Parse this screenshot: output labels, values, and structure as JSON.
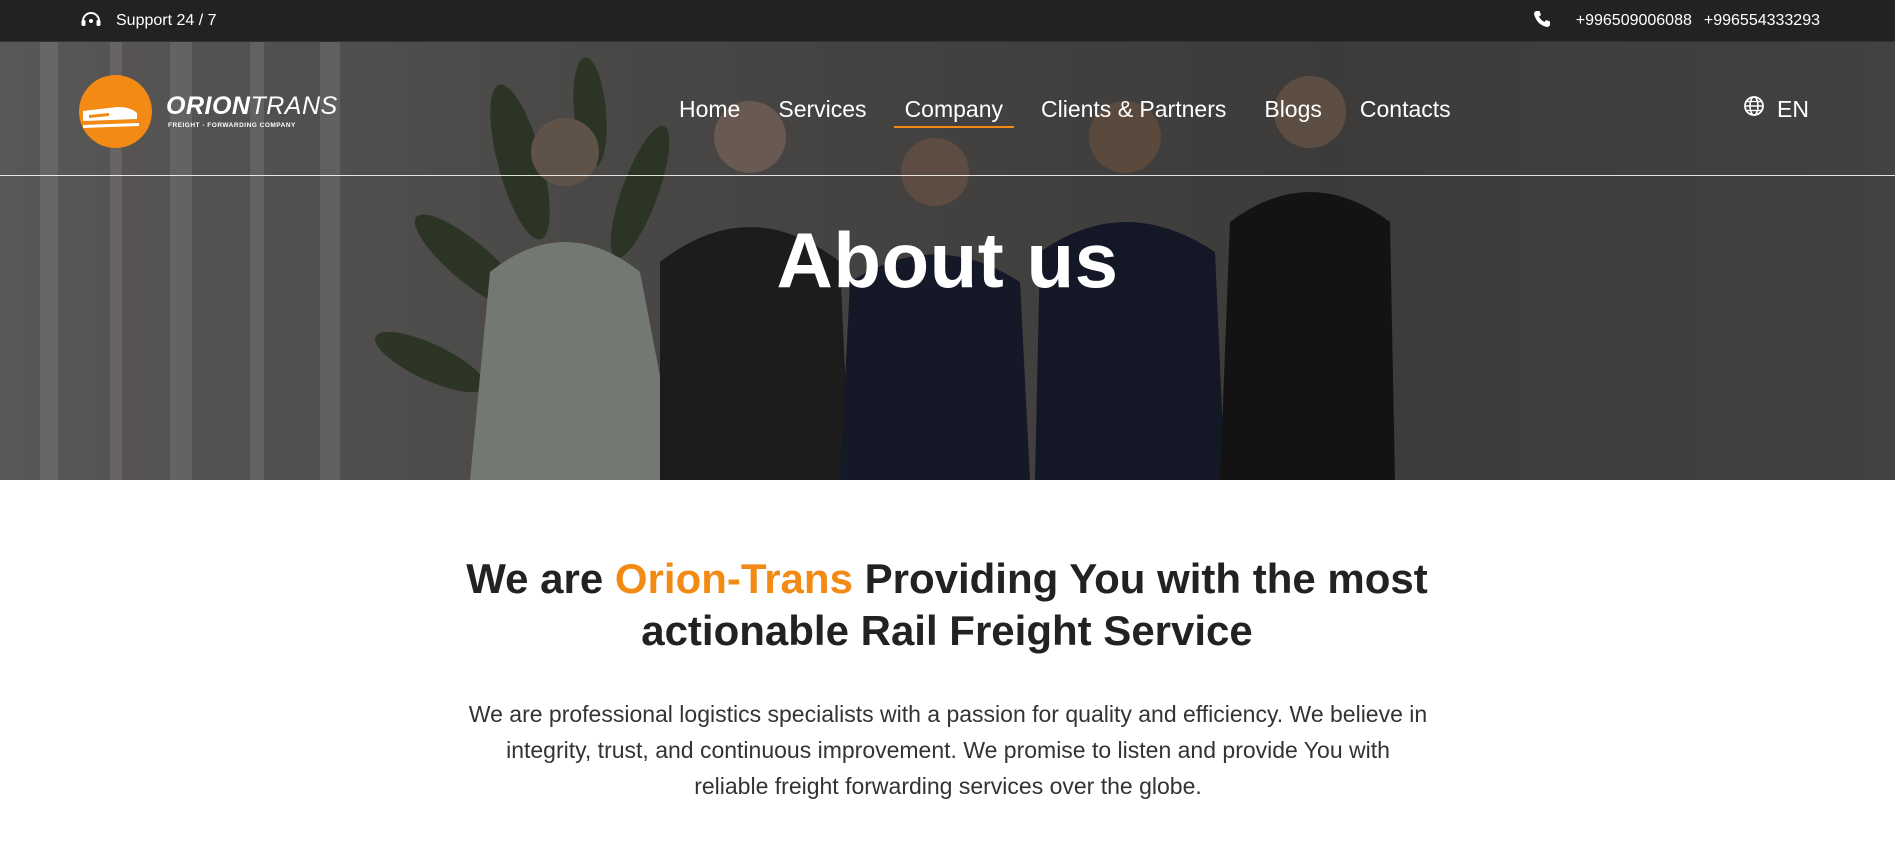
{
  "topbar": {
    "support_label": "Support 24 / 7",
    "phone_1": "+996509006088",
    "phone_2": "+996554333293",
    "icons": {
      "support": "headset-icon",
      "phone": "phone-icon"
    }
  },
  "logo": {
    "brand_bold": "ORION",
    "brand_light": "TRANS",
    "tagline": "FREIGHT - FORWARDING COMPANY"
  },
  "nav": {
    "items": [
      {
        "label": "Home",
        "active": false
      },
      {
        "label": "Services",
        "active": false
      },
      {
        "label": "Company",
        "active": true
      },
      {
        "label": "Clients & Partners",
        "active": false
      },
      {
        "label": "Blogs",
        "active": false
      },
      {
        "label": "Contacts",
        "active": false
      }
    ],
    "language": "EN"
  },
  "hero": {
    "title": "About us"
  },
  "intro": {
    "headline_pre": "We are ",
    "headline_accent": "Orion-Trans",
    "headline_post": " Providing You with the most actionable Rail Freight Service",
    "paragraph": "We are professional logistics specialists with a passion for quality and efficiency. We believe in integrity, trust, and continuous improvement. We promise to listen and provide You with reliable freight forwarding services over the globe."
  },
  "colors": {
    "accent": "#f28a14",
    "topbar": "#222222",
    "text_dark": "#222222"
  }
}
